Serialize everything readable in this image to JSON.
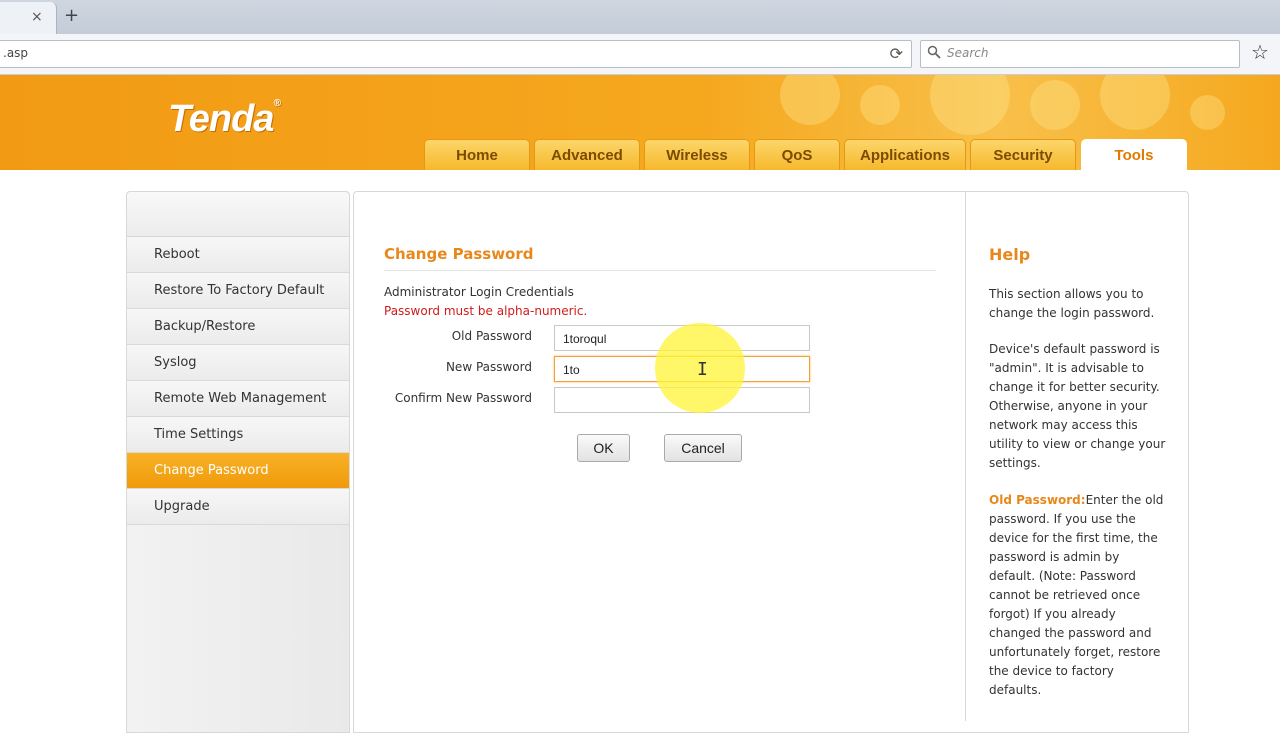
{
  "browser": {
    "url": ".asp",
    "search_placeholder": "Search",
    "tab_close_glyph": "×",
    "new_tab_glyph": "+",
    "reload_glyph": "⟳",
    "star_glyph": "☆"
  },
  "brand": {
    "logo": "Tenda",
    "reg_mark": "®"
  },
  "nav": {
    "tabs": [
      {
        "label": "Home"
      },
      {
        "label": "Advanced"
      },
      {
        "label": "Wireless"
      },
      {
        "label": "QoS"
      },
      {
        "label": "Applications"
      },
      {
        "label": "Security"
      },
      {
        "label": "Tools",
        "active": true
      }
    ]
  },
  "sidebar": {
    "items": [
      {
        "label": "Reboot"
      },
      {
        "label": "Restore To Factory Default"
      },
      {
        "label": "Backup/Restore"
      },
      {
        "label": "Syslog"
      },
      {
        "label": "Remote Web Management"
      },
      {
        "label": "Time Settings"
      },
      {
        "label": "Change Password",
        "active": true
      },
      {
        "label": "Upgrade"
      }
    ]
  },
  "main": {
    "title": "Change Password",
    "credentials_label": "Administrator Login Credentials",
    "warning": "Password must be alpha-numeric.",
    "fields": [
      {
        "label": "Old Password",
        "value": "1toroqul"
      },
      {
        "label": "New Password",
        "value": "1to"
      },
      {
        "label": "Confirm New Password",
        "value": ""
      }
    ],
    "ok_label": "OK",
    "cancel_label": "Cancel",
    "text_cursor_glyph": "I"
  },
  "help": {
    "title": "Help",
    "p1": "This section allows you to change the login password.",
    "p2": "Device's default password is \"admin\". It is advisable to change it for better security. Otherwise, anyone in your network may access this utility to view or change your settings.",
    "p3_term": "Old Password:",
    "p3": "Enter the old password. If you use the device for the first time, the password is admin by default. (Note: Password cannot be retrieved once forgot) If you already changed the password and unfortunately forget, restore the device to factory defaults."
  },
  "colors": {
    "brand_orange": "#f29a14",
    "accent_orange": "#e8881a",
    "warning_red": "#d11b1b",
    "active_tab_text": "#e07b00"
  }
}
